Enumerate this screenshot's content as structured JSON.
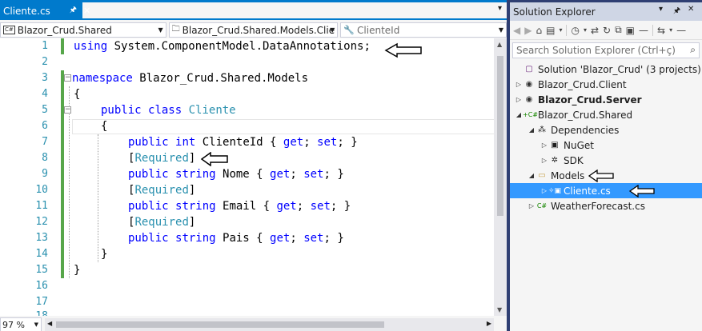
{
  "editor": {
    "tab": {
      "title": "Cliente.cs",
      "pin_icon": "pin-icon",
      "close_icon": "close-icon"
    },
    "nav": {
      "project": "Blazor_Crud.Shared",
      "type": "Blazor_Crud.Shared.Models.Clie",
      "member": "ClienteId"
    },
    "line_numbers": [
      "1",
      "2",
      "3",
      "4",
      "5",
      "6",
      "7",
      "8",
      "9",
      "10",
      "11",
      "12",
      "13",
      "14",
      "15",
      "16",
      "17",
      "18"
    ],
    "code": {
      "l1_kw": "using",
      "l1_rest": " System.ComponentModel.DataAnnotations;",
      "l3_kw": "namespace",
      "l3_rest": " Blazor_Crud.Shared.Models",
      "l4": "{",
      "l5_kw1": "public",
      "l5_kw2": "class",
      "l5_type": "Cliente",
      "l6": "{",
      "l7_kw1": "public",
      "l7_kw2": "int",
      "l7_name": " ClienteId { ",
      "l7_get": "get",
      "l7_mid": "; ",
      "l7_set": "set",
      "l7_end": "; }",
      "attr_open": "[",
      "attr_name": "Required",
      "attr_close": "]",
      "l9_kw1": "public",
      "l9_kw2": "string",
      "l9_name": " Nome { ",
      "l11_name": " Email { ",
      "l13_name": " Pais { ",
      "l15": "}",
      "l16": "}"
    },
    "zoom": "97 %"
  },
  "solution_explorer": {
    "title": "Solution Explorer",
    "search_placeholder": "Search Solution Explorer (Ctrl+ç)",
    "tree": [
      {
        "label": "Solution 'Blazor_Crud' (3 projects)"
      },
      {
        "label": "Blazor_Crud.Client"
      },
      {
        "label": "Blazor_Crud.Server"
      },
      {
        "label": "Blazor_Crud.Shared"
      },
      {
        "label": "Dependencies"
      },
      {
        "label": "NuGet"
      },
      {
        "label": "SDK"
      },
      {
        "label": "Models"
      },
      {
        "label": "Cliente.cs"
      },
      {
        "label": "WeatherForecast.cs"
      }
    ]
  },
  "colors": {
    "accent": "#007acc",
    "selection": "#3399ff",
    "keyword": "#0000ff",
    "type": "#2b91af",
    "change_bar": "#57a64a"
  }
}
